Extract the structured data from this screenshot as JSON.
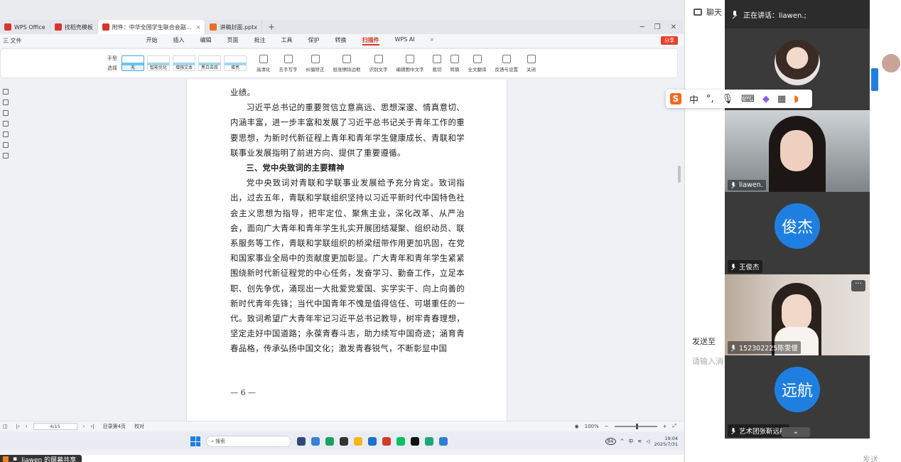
{
  "wps": {
    "tabs": [
      {
        "label": "WPS Office",
        "color": "#d8352a"
      },
      {
        "label": "找稻壳模板",
        "color": "#d8352a"
      },
      {
        "label": "附件：中华全国学生联合会副…",
        "color": "#d8352a"
      },
      {
        "label": "讲稿封面.pptx",
        "color": "#e5731f"
      }
    ],
    "file_menu": "三 文件",
    "menus": [
      "开始",
      "插入",
      "编辑",
      "页面",
      "批注",
      "工具",
      "保护",
      "转换",
      "扫描件",
      "WPS AI"
    ],
    "active_menu": "扫描件",
    "share_label": "分享",
    "ribbon": {
      "tool_hand": "手型",
      "tool_select": "选择",
      "styles": [
        "无",
        "智能优化",
        "增强文本",
        "黑白去底",
        "增亮"
      ],
      "buttons": [
        "高清化",
        "去手写字",
        "纠偏矫正",
        "纸张擦除边框",
        "识别文字",
        "编辑图中文字",
        "裁切",
        "转换",
        "全文翻译",
        "反馈与设置",
        "关闭"
      ]
    }
  },
  "document": {
    "paragraphs": [
      {
        "kind": "plain",
        "text": "业绩。"
      },
      {
        "kind": "ind",
        "text": "习近平总书记的重要贺信立意高远、思想深邃、情真意切、内涵丰富，进一步丰富和发展了习近平总书记关于青年工作的重要思想，为新时代新征程上青年和青年学生健康成长、青联和学联事业发展指明了前进方向、提供了重要遵循。"
      },
      {
        "kind": "head",
        "text": "三、党中央致词的主要精神"
      },
      {
        "kind": "ind",
        "text": "党中央致词对青联和学联事业发展给予充分肯定。致词指出，过去五年，青联和学联组织坚持以习近平新时代中国特色社会主义思想为指导，把牢定位、聚焦主业，深化改革、从严治会，面向广大青年和青年学生扎实开展团结凝聚、组织动员、联系服务等工作，青联和学联组织的桥梁纽带作用更加巩固，在党和国家事业全局中的贡献度更加彰显。广大青年和青年学生紧紧围绕新时代新征程党的中心任务，发奋学习、勤奋工作，立足本职、创先争优，涌现出一大批爱党爱国、实学实干、向上向善的新时代青年先锋；当代中国青年不愧是值得信任、可堪重任的一代。致词希望广大青年牢记习近平总书记教导，树牢青春理想，坚定走好中国道路；永葆青春斗志，助力续写中国奇迹；涵育青春品格，传承弘扬中国文化；激发青春锐气，不断彰显中国"
      }
    ],
    "page_number": "— 6 —"
  },
  "status": {
    "page_box": "4/15",
    "page_info": "目录第4页",
    "proof": "校对",
    "zoom": "100%"
  },
  "taskbar": {
    "search": "搜索",
    "badge": "84",
    "ime": "中",
    "time": "19:04",
    "date": "2025/7/31"
  },
  "ime_bar": {
    "logo": "S",
    "lang": "中"
  },
  "meeting": {
    "speaking_label": "正在讲话：liawen.;",
    "participants": [
      {
        "name": "liawen.",
        "type": "video"
      },
      {
        "name": "王俊杰",
        "type": "avatar",
        "initials": "俊杰"
      },
      {
        "name": "152302225陈雯偃",
        "type": "video"
      },
      {
        "name": "艺术团张靳远航",
        "type": "avatar",
        "initials": "远航"
      }
    ]
  },
  "chat": {
    "title": "聊天",
    "send_to": "发送至",
    "input_placeholder": "请输入消",
    "send_label": "发送",
    "share_banner": "liawen 的屏幕共享"
  },
  "colors": {
    "accent_red": "#d23a2a",
    "avatar_blue": "#1f7fe0",
    "panel_dark": "#3a3a3a"
  }
}
